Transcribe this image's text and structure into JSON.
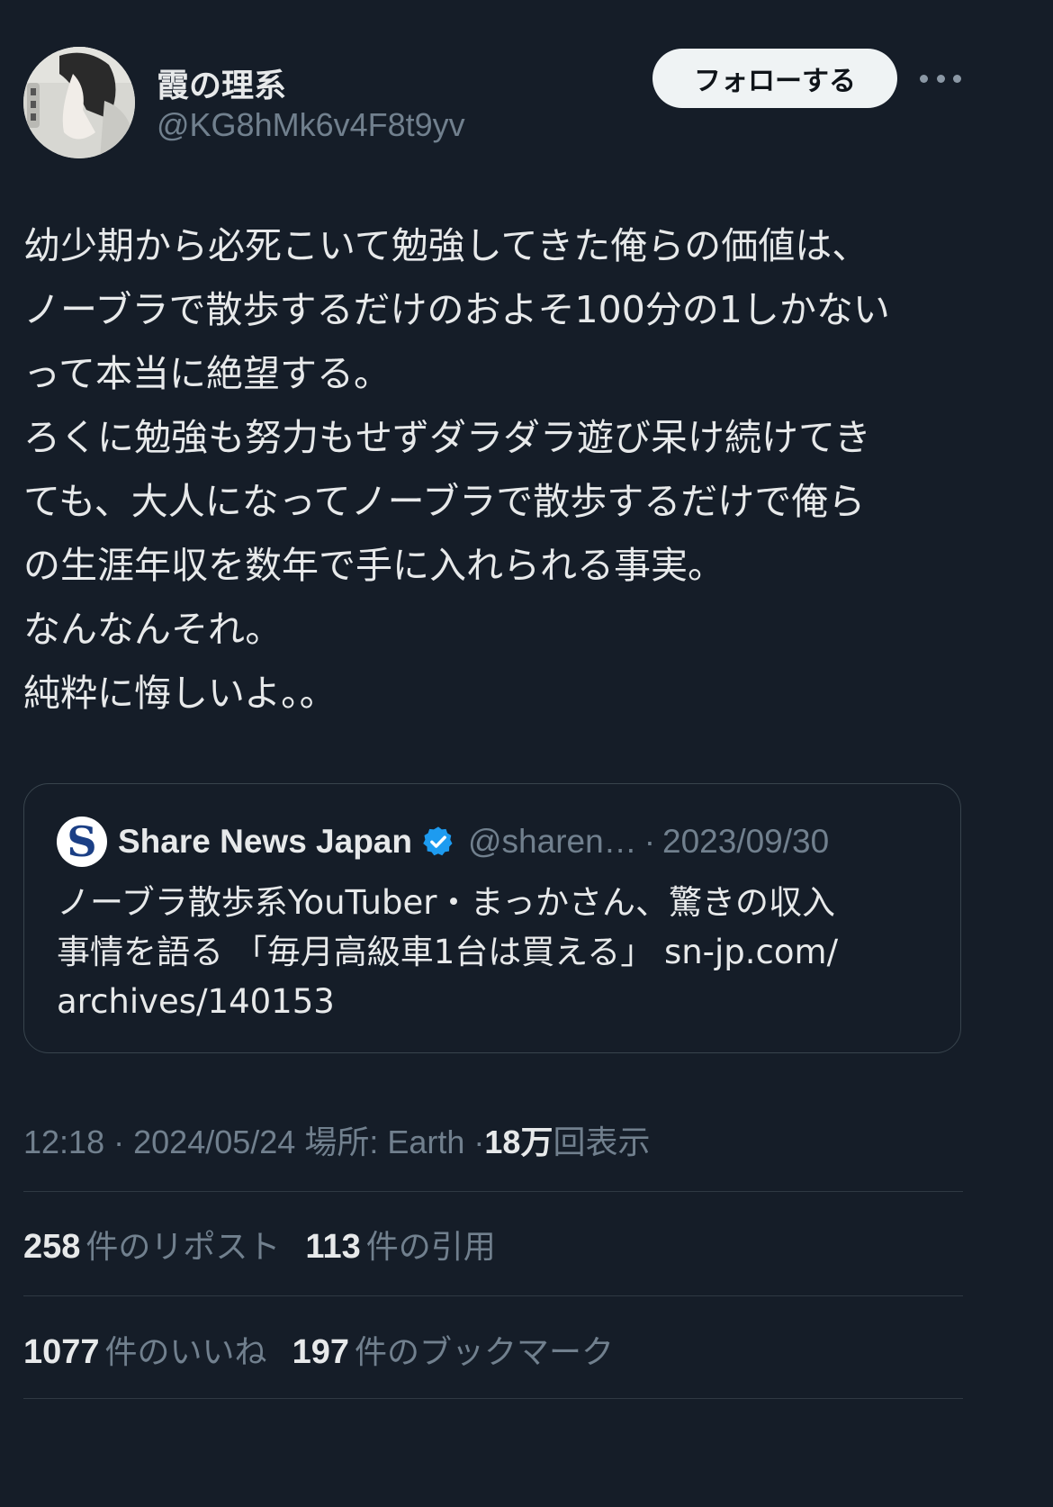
{
  "author": {
    "display_name": "霞の理系",
    "handle": "@KG8hMk6v4F8t9yv"
  },
  "header": {
    "follow_label": "フォローする"
  },
  "tweet": {
    "text": "幼少期から必死こいて勉強してきた俺らの価値は、\nノーブラで散歩するだけのおよそ100分の1しかない\nって本当に絶望する。\nろくに勉強も努力もせずダラダラ遊び呆け続けてき\nても、大人になってノーブラで散歩するだけで俺ら\nの生涯年収を数年で手に入れられる事実。\nなんなんそれ。\n純粋に悔しいよ。。"
  },
  "quote": {
    "avatar_letter": "S",
    "name": "Share News Japan",
    "handle": "@sharen…",
    "separator": "·",
    "date": "2023/09/30",
    "text": "ノーブラ散歩系YouTuber・まっかさん、驚きの収入\n事情を語る 「毎月高級車1台は買える」 sn-jp.com/\narchives/140153"
  },
  "meta": {
    "time": "12:18",
    "sep1": "·",
    "date": "2024/05/24",
    "location": "場所: Earth",
    "sep2": "·",
    "views_count": "18万",
    "views_label": "回表示"
  },
  "stats": {
    "reposts_count": "258",
    "reposts_label": "件のリポスト",
    "quotes_count": "113",
    "quotes_label": "件の引用",
    "likes_count": "1077",
    "likes_label": "件のいいね",
    "bookmarks_count": "197",
    "bookmarks_label": "件のブックマーク"
  },
  "icons": {
    "more": "more-horizontal-icon",
    "verified": "verified-badge-icon"
  },
  "colors": {
    "background": "#151d28",
    "primary_text": "#e7e9ea",
    "secondary_text": "#71808e",
    "follow_button_bg": "#eff3f4",
    "verified_blue": "#1d9bf0",
    "border": "#38444d"
  }
}
